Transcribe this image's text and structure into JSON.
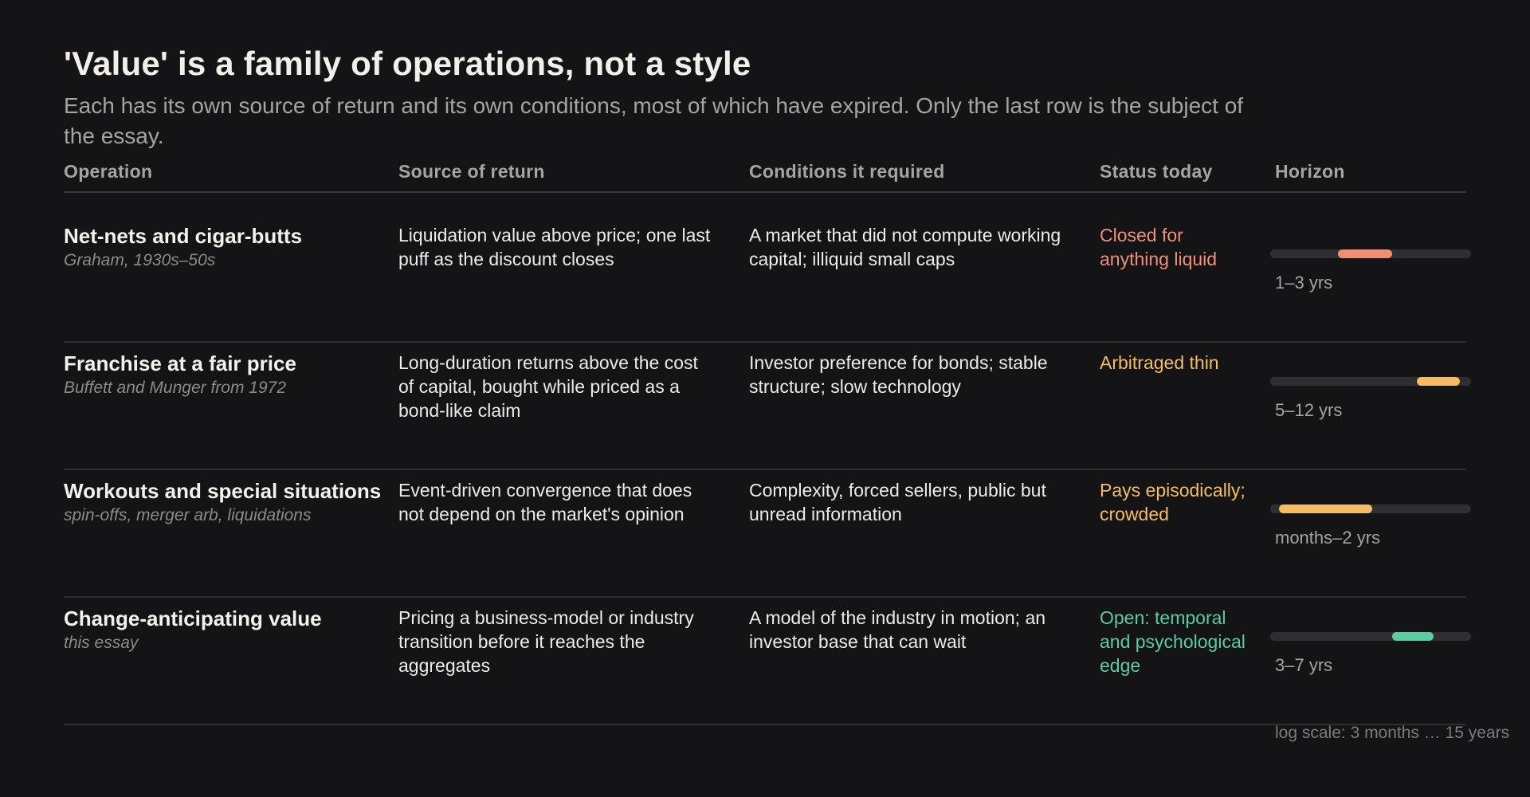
{
  "title": "'Value' is a family of operations, not a style",
  "subtitle": "Each has its own source of return and its own conditions, most of which have expired. Only the last row is the subject of the essay.",
  "columns": {
    "operation": "Operation",
    "source": "Source of return",
    "conditions": "Conditions it required",
    "status": "Status today",
    "horizon": "Horizon"
  },
  "rows": [
    {
      "name": "Net-nets and cigar-butts",
      "sub": "Graham, 1930s–50s",
      "source": "Liquidation value above price; one last puff as the discount closes",
      "conditions": "A market that did not compute working capital; illiquid small caps",
      "status": "Closed for anything liquid",
      "status_color": "#ef8f78",
      "horizon_label": "1–3 yrs",
      "horizon_years": [
        1,
        3
      ],
      "bar_color": "#ef8f78"
    },
    {
      "name": "Franchise at a fair price",
      "sub": "Buffett and Munger from 1972",
      "source": "Long-duration returns above the cost of capital, bought while priced as a bond-like claim",
      "conditions": "Investor preference for bonds; stable structure; slow technology",
      "status": "Arbitraged thin",
      "status_color": "#f5bd63",
      "horizon_label": "5–12 yrs",
      "horizon_years": [
        5,
        12
      ],
      "bar_color": "#f5bd63"
    },
    {
      "name": "Workouts and special situations",
      "sub": "spin-offs, merger arb, liquidations",
      "source": "Event-driven convergence that does not depend on the market's opinion",
      "conditions": "Complexity, forced sellers, public but unread information",
      "status": "Pays episodically; crowded",
      "status_color": "#f5bd63",
      "horizon_label": "months–2 yrs",
      "horizon_years": [
        0.3,
        2
      ],
      "bar_color": "#f5bd63"
    },
    {
      "name": "Change-anticipating value",
      "sub": "this essay",
      "source": "Pricing a business-model or industry transition before it reaches the aggregates",
      "conditions": "A model of the industry in motion; an investor base that can wait",
      "status": "Open: temporal and psychological edge",
      "status_color": "#5ccaa2",
      "horizon_label": "3–7 yrs",
      "horizon_years": [
        3,
        7
      ],
      "bar_color": "#5ccaa2"
    }
  ],
  "scale_note": "log scale: 3 months … 15 years",
  "scale_range_years": [
    0.25,
    15
  ]
}
